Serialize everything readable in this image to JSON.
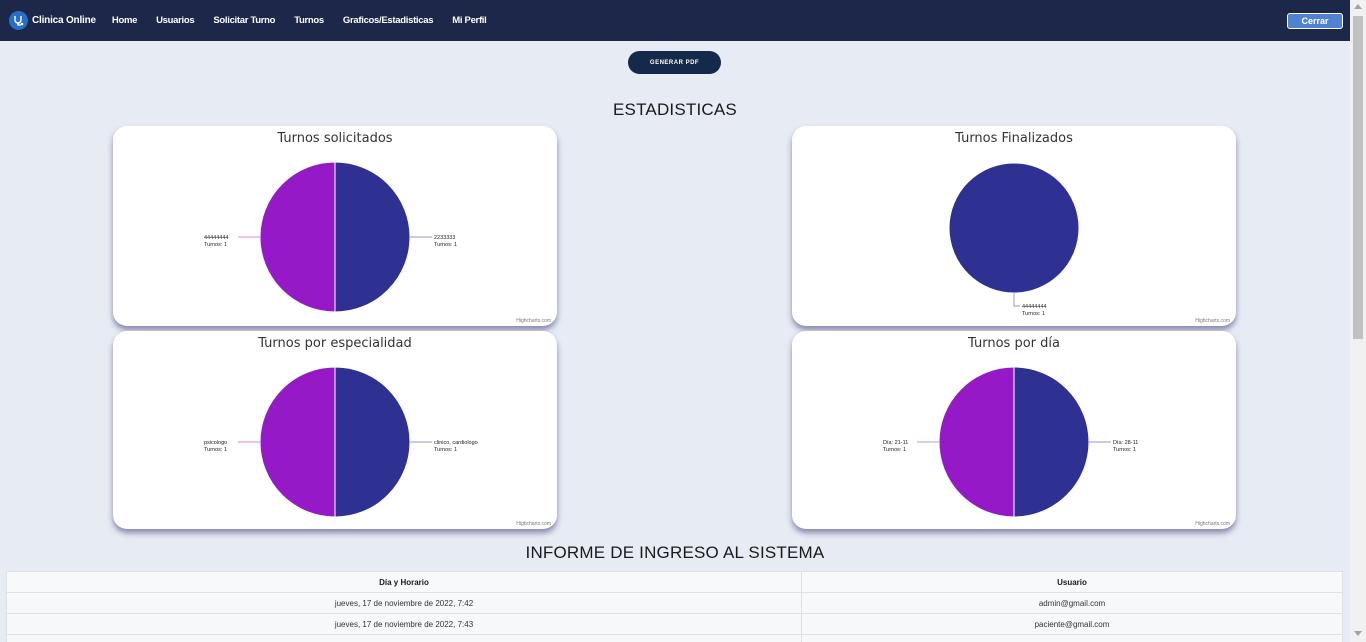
{
  "navbar": {
    "brand": "Clinica Online",
    "links": [
      "Home",
      "Usuarios",
      "Solicitar Turno",
      "Turnos",
      "Graficos/Estadisticas",
      "Mi Perfil"
    ],
    "logout": "Cerrar"
  },
  "pdf_button": "GENERAR PDF",
  "stats_title": "ESTADISTICAS",
  "credits": "Highcharts.com",
  "chart_data": [
    {
      "type": "pie",
      "title": "Turnos solicitados",
      "series": [
        {
          "label": "2233333",
          "detail": "Turnos: 1",
          "value": 1,
          "color": "#2e3192"
        },
        {
          "label": "44444444",
          "detail": "Turnos: 1",
          "value": 1,
          "color": "#9519c6"
        }
      ]
    },
    {
      "type": "pie",
      "title": "Turnos Finalizados",
      "series": [
        {
          "label": "44444444",
          "detail": "Turnos: 1",
          "value": 1,
          "color": "#2e3192"
        }
      ]
    },
    {
      "type": "pie",
      "title": "Turnos por especialidad",
      "series": [
        {
          "label": "clinico, cardiologo",
          "detail": "Turnos: 1",
          "value": 1,
          "color": "#2e3192"
        },
        {
          "label": "psicologo",
          "detail": "Turnos: 1",
          "value": 1,
          "color": "#9519c6"
        }
      ]
    },
    {
      "type": "pie",
      "title": "Turnos por día",
      "series": [
        {
          "label": "Día: 28-11",
          "detail": "Turnos: 1",
          "value": 1,
          "color": "#2e3192"
        },
        {
          "label": "Día: 21-11",
          "detail": "Turnos: 1",
          "value": 1,
          "color": "#9519c6"
        }
      ]
    }
  ],
  "report": {
    "title": "INFORME DE INGRESO AL SISTEMA",
    "headers": [
      "Día y Horario",
      "Usuario"
    ],
    "rows": [
      [
        "jueves, 17 de noviembre de 2022, 7:42",
        "admin@gmail.com"
      ],
      [
        "jueves, 17 de noviembre de 2022, 7:43",
        "paciente@gmail.com"
      ]
    ]
  }
}
